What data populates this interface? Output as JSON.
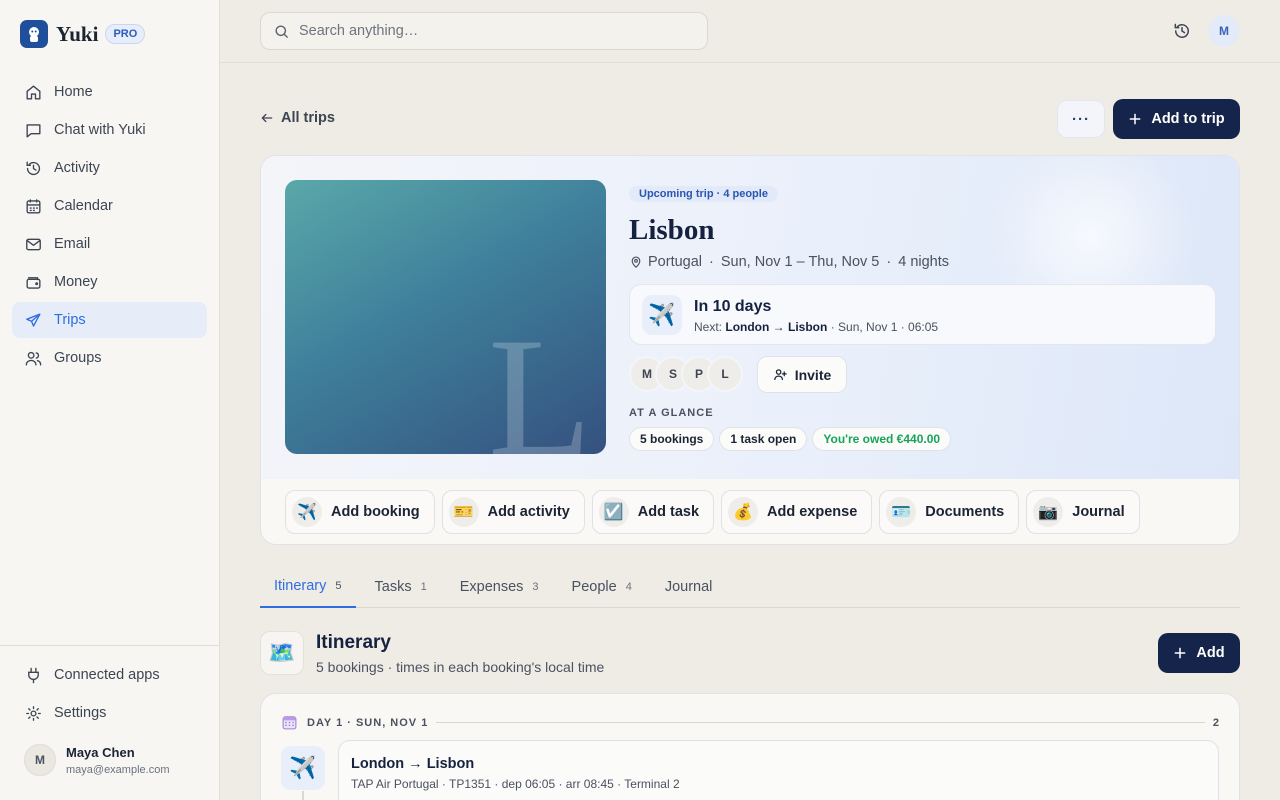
{
  "app": {
    "name": "Yuki",
    "badge": "PRO"
  },
  "sidebar": {
    "items": [
      {
        "label": "Home",
        "icon": "home-icon"
      },
      {
        "label": "Chat with Yuki",
        "icon": "chat-icon"
      },
      {
        "label": "Activity",
        "icon": "history-icon"
      },
      {
        "label": "Calendar",
        "icon": "calendar-icon"
      },
      {
        "label": "Email",
        "icon": "mail-icon"
      },
      {
        "label": "Money",
        "icon": "wallet-icon"
      },
      {
        "label": "Trips",
        "icon": "plane-icon",
        "active": true
      },
      {
        "label": "Groups",
        "icon": "users-icon"
      }
    ],
    "bottom": [
      {
        "label": "Connected apps",
        "icon": "plug-icon"
      },
      {
        "label": "Settings",
        "icon": "gear-icon"
      }
    ],
    "user": {
      "initial": "M",
      "name": "Maya Chen",
      "email": "maya@example.com"
    }
  },
  "topbar": {
    "search_placeholder": "Search anything…",
    "avatar_initial": "M"
  },
  "header": {
    "back_label": "All trips",
    "more_label": "···",
    "add_to_trip_label": "Add to trip"
  },
  "trip": {
    "badge": "Upcoming trip · 4 people",
    "title": "Lisbon",
    "image_letter": "L",
    "country": "Portugal",
    "dates": "Sun, Nov 1 – Thu, Nov 5",
    "nights": "4 nights",
    "countdown": {
      "title": "In 10 days",
      "next_prefix": "Next:",
      "next_route": "London → Lisbon",
      "next_time": "· Sun, Nov 1 · 06:05"
    },
    "people": [
      "M",
      "S",
      "P",
      "L"
    ],
    "invite_label": "Invite",
    "glance_label": "AT A GLANCE",
    "chips": {
      "bookings": "5 bookings",
      "tasks": "1 task open",
      "owed": "You're owed €440.00"
    },
    "owed_color": "#18a35a"
  },
  "actions": [
    {
      "label": "Add booking",
      "emoji": "✈️"
    },
    {
      "label": "Add activity",
      "emoji": "🎫"
    },
    {
      "label": "Add task",
      "emoji": "☑️"
    },
    {
      "label": "Add expense",
      "emoji": "💰"
    },
    {
      "label": "Documents",
      "emoji": "🪪"
    },
    {
      "label": "Journal",
      "emoji": "📷"
    }
  ],
  "tabs": [
    {
      "label": "Itinerary",
      "count": "5",
      "active": true
    },
    {
      "label": "Tasks",
      "count": "1"
    },
    {
      "label": "Expenses",
      "count": "3"
    },
    {
      "label": "People",
      "count": "4"
    },
    {
      "label": "Journal",
      "count": ""
    }
  ],
  "itinerary": {
    "emoji": "🗺️",
    "title": "Itinerary",
    "subtitle": "5 bookings · times in each booking's local time",
    "add_label": "Add",
    "day": {
      "label": "DAY 1 · SUN, NOV 1",
      "count": "2"
    },
    "booking": {
      "emoji": "✈️",
      "title": "London → Lisbon",
      "detail": "TAP Air Portugal · TP1351 · dep 06:05 · arr 08:45 · Terminal 2"
    }
  },
  "colors": {
    "accent": "#2f6de0",
    "primary_button": "#15244a"
  }
}
